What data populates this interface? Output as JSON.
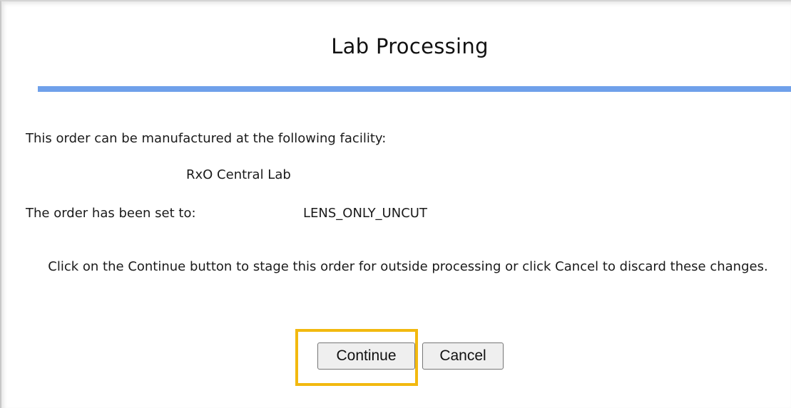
{
  "dialog": {
    "title": "Lab Processing",
    "facility_intro": "This order can be manufactured at the following facility:",
    "facility_name": "RxO Central Lab",
    "order_set_label": "The order has been set to:",
    "order_set_value": "LENS_ONLY_UNCUT",
    "instructions": "Click on the Continue button to stage this order for outside processing or click Cancel to discard these changes.",
    "divider_color": "#6fa0ea",
    "highlight_color": "#f2b90f"
  },
  "buttons": {
    "continue_label": "Continue",
    "cancel_label": "Cancel"
  }
}
